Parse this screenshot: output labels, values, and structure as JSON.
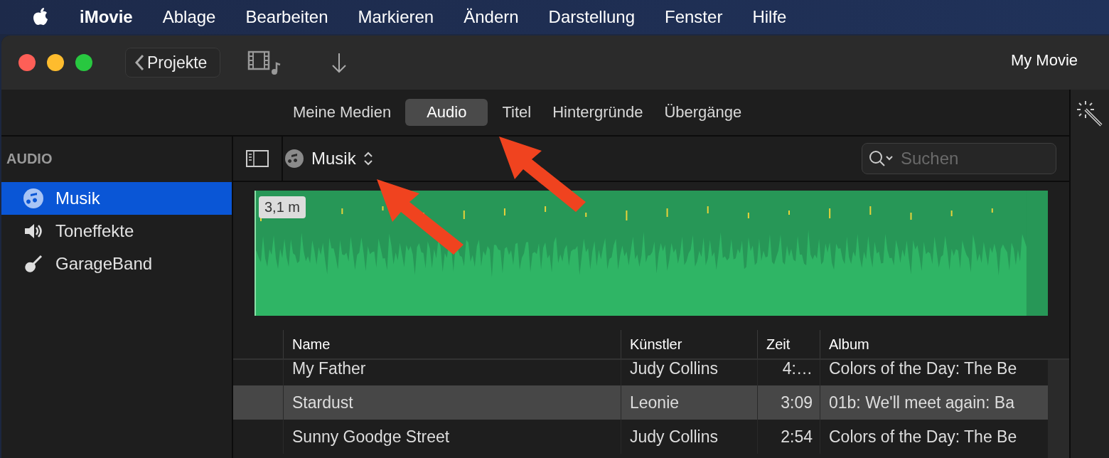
{
  "menu_bar": {
    "app_name": "iMovie",
    "items": [
      "Ablage",
      "Bearbeiten",
      "Markieren",
      "Ändern",
      "Darstellung",
      "Fenster",
      "Hilfe"
    ]
  },
  "toolbar": {
    "back_button": "Projekte",
    "project_title": "My Movie"
  },
  "tabs": [
    {
      "label": "Meine Medien",
      "selected": false
    },
    {
      "label": "Audio",
      "selected": true
    },
    {
      "label": "Titel",
      "selected": false
    },
    {
      "label": "Hintergründe",
      "selected": false
    },
    {
      "label": "Übergänge",
      "selected": false
    }
  ],
  "sidebar": {
    "heading": "AUDIO",
    "items": [
      {
        "label": "Musik",
        "kind": "music",
        "selected": true
      },
      {
        "label": "Toneffekte",
        "kind": "sound",
        "selected": false
      },
      {
        "label": "GarageBand",
        "kind": "guitar",
        "selected": false
      }
    ]
  },
  "browser": {
    "source": "Musik",
    "search": {
      "placeholder": "Suchen"
    },
    "clip": {
      "duration": "3,1 m"
    },
    "table": {
      "columns": [
        "Name",
        "Künstler",
        "Zeit",
        "Album"
      ],
      "rows": [
        {
          "cells": [
            "My Father",
            "Judy Collins",
            "4:…",
            "Colors of the Day: The Be"
          ],
          "selected": false
        },
        {
          "cells": [
            "Stardust",
            "Leonie",
            "3:09",
            "01b: We'll meet again: Ba"
          ],
          "selected": true
        },
        {
          "cells": [
            "Sunny Goodge Street",
            "Judy Collins",
            "2:54",
            "Colors of the Day: The Be"
          ],
          "selected": false
        }
      ]
    }
  },
  "annotations": [
    {
      "kind": "arrow"
    },
    {
      "kind": "arrow"
    }
  ]
}
